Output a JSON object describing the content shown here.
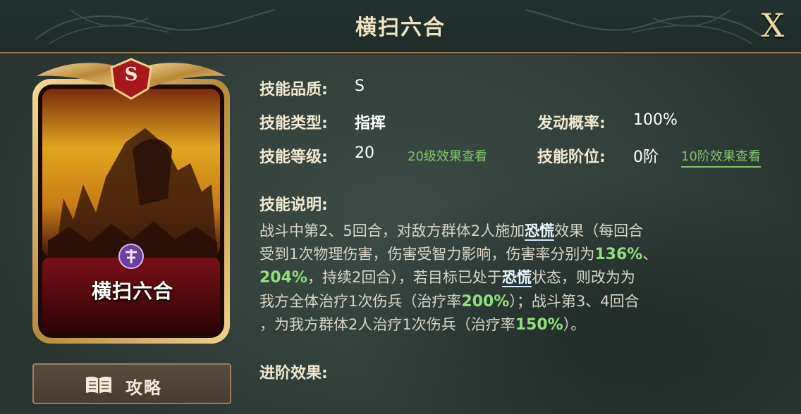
{
  "header": {
    "title": "横扫六合",
    "close_label": "X"
  },
  "card": {
    "name": "横扫六合",
    "grade": "S"
  },
  "strategy_button": {
    "label": "攻略"
  },
  "info": {
    "quality_label": "技能品质:",
    "quality_value": "S",
    "type_label": "技能类型:",
    "type_value": "指挥",
    "probability_label": "发动概率:",
    "probability_value": "100%",
    "level_label": "技能等级:",
    "level_value": "20",
    "level_link": "20级效果查看",
    "rank_label": "技能阶位:",
    "rank_value": "0阶",
    "rank_link": "10阶效果查看",
    "description_label": "技能说明:",
    "advance_label": "进阶效果:"
  },
  "description": {
    "l1a": "战斗中第2、5回合，对敌方群体2人施加",
    "l1k": "恐慌",
    "l1b": "效果（每回合",
    "l2a": "受到1次物理伤害，伤害受智力影响，伤害率分别为",
    "l2g": "136%",
    "l2b": "、",
    "l3g": "204%",
    "l3a": "，持续2回合），若目标已处于",
    "l3k": "恐慌",
    "l3b": "状态，则改为为",
    "l4a": "我方全体治疗1次伤兵（治疗率",
    "l4g": "200%",
    "l4b": "）；战斗第3、4回合",
    "l5a": "，为我方群体2人治疗1次伤兵（治疗率",
    "l5g": "150%",
    "l5b": "）。"
  },
  "colors": {
    "accent_green": "#8fe07a",
    "link_green": "#7fc46a",
    "gold": "#c9a45a",
    "text": "#f1e8d0"
  },
  "icons": {
    "close": "close-icon",
    "book": "book-icon",
    "grade": "grade-badge-icon",
    "emblem": "faction-emblem-icon"
  }
}
